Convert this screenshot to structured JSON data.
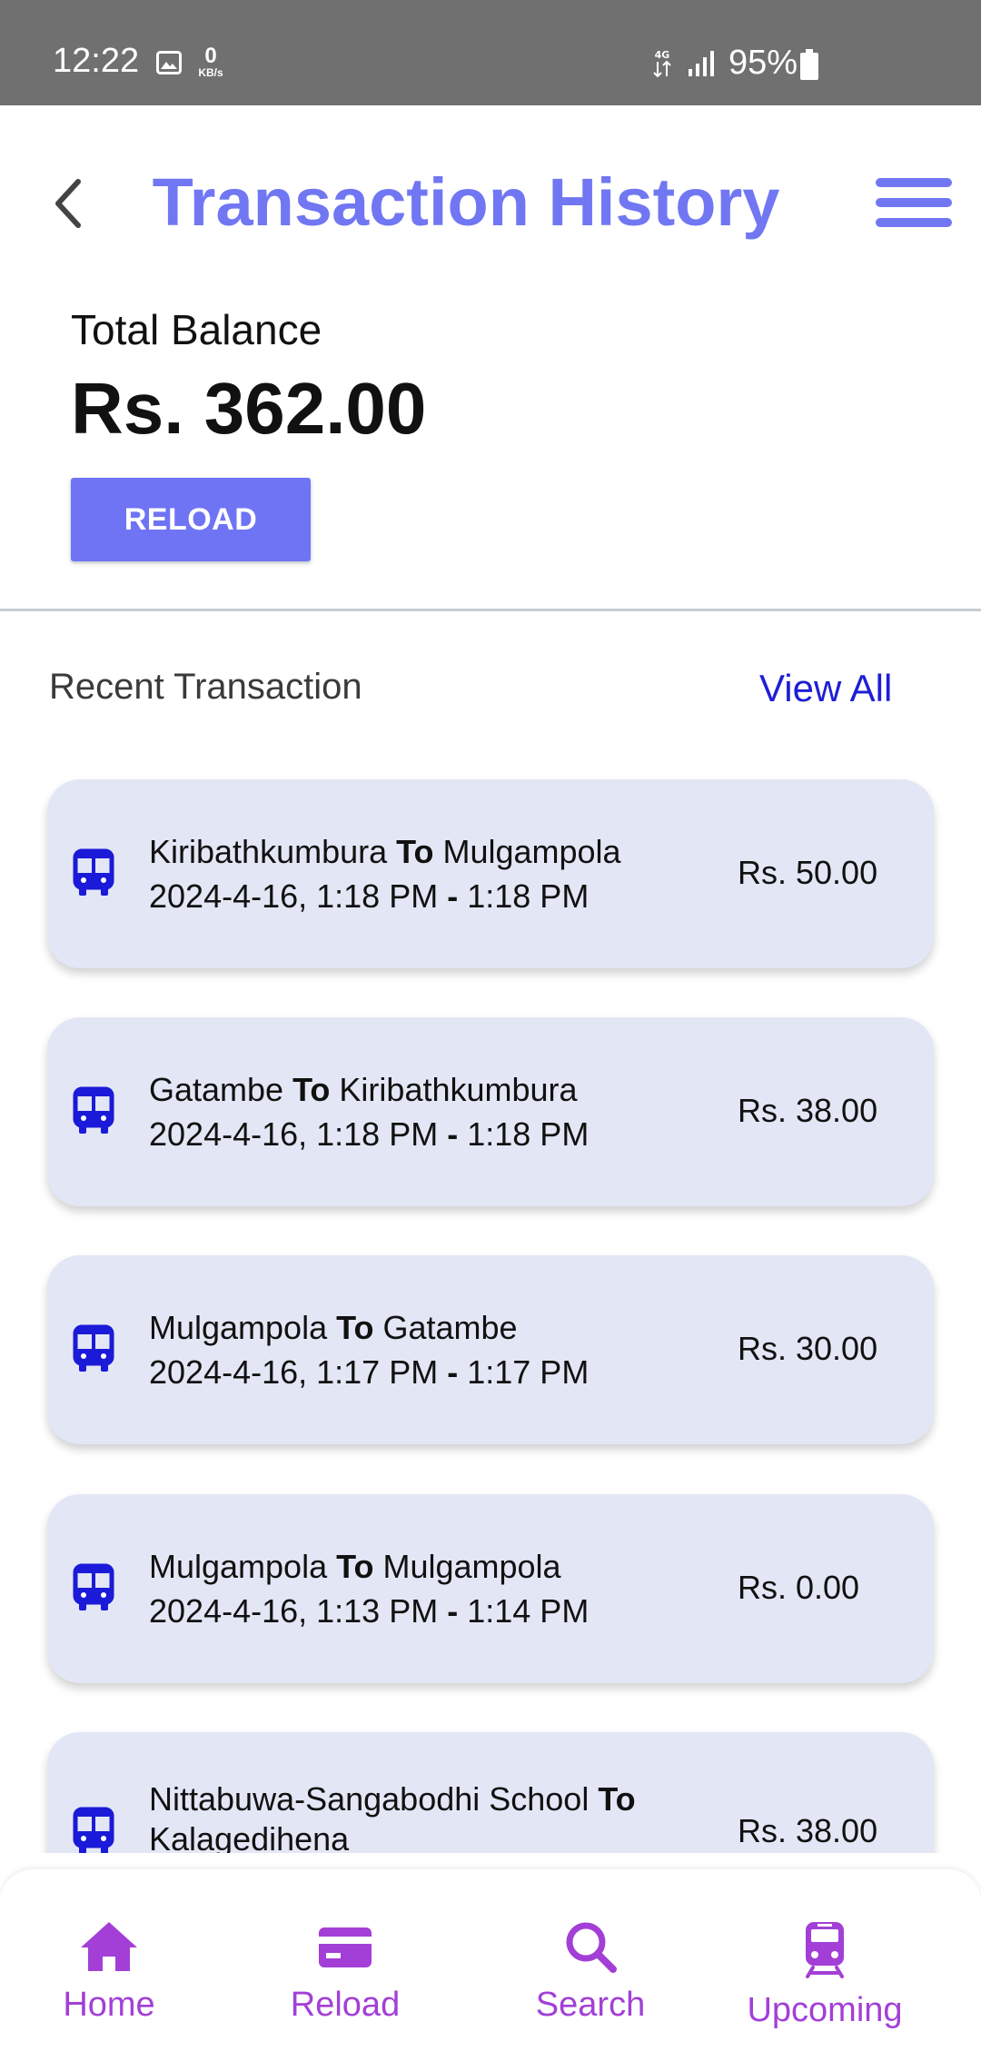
{
  "status_bar": {
    "time": "12:22",
    "data_rate_value": "0",
    "data_rate_unit": "KB/s",
    "battery": "95%"
  },
  "header": {
    "title": "Transaction History"
  },
  "balance": {
    "label": "Total Balance",
    "value": "Rs. 362.00",
    "reload_label": "RELOAD"
  },
  "recent": {
    "title": "Recent Transaction",
    "view_all": "View All"
  },
  "transactions": [
    {
      "from": "Kiribathkumbura",
      "connector": "To",
      "to": "Mulgampola",
      "start": "2024-4-16, 1:18 PM",
      "sep": "-",
      "end": "1:18 PM",
      "amount": "Rs. 50.00"
    },
    {
      "from": "Gatambe",
      "connector": "To",
      "to": "Kiribathkumbura",
      "start": "2024-4-16, 1:18 PM",
      "sep": "-",
      "end": "1:18 PM",
      "amount": "Rs. 38.00"
    },
    {
      "from": "Mulgampola",
      "connector": "To",
      "to": "Gatambe",
      "start": "2024-4-16, 1:17 PM",
      "sep": "-",
      "end": "1:17 PM",
      "amount": "Rs. 30.00"
    },
    {
      "from": "Mulgampola",
      "connector": "To",
      "to": "Mulgampola",
      "start": "2024-4-16, 1:13 PM",
      "sep": "-",
      "end": "1:14 PM",
      "amount": "Rs. 0.00"
    },
    {
      "from": "Nittabuwa-Sangabodhi School",
      "connector": "To",
      "to": "Kalagedihena",
      "amount": "Rs. 38.00"
    }
  ],
  "nav": {
    "home": "Home",
    "reload": "Reload",
    "search": "Search",
    "upcoming": "Upcoming"
  },
  "icons": {
    "back": "chevron-left-icon",
    "menu": "hamburger-menu-icon",
    "bus": "bus-icon",
    "home": "home-icon",
    "reload": "credit-card-icon",
    "search": "search-icon",
    "upcoming": "train-icon"
  },
  "colors": {
    "accent": "#7177f2",
    "button": "#6f74f5",
    "link": "#1e1ed6",
    "card_bg": "#e3e6f5",
    "bus_icon": "#1a1ad8",
    "nav": "#a33fd6",
    "status_bar": "#707070"
  }
}
